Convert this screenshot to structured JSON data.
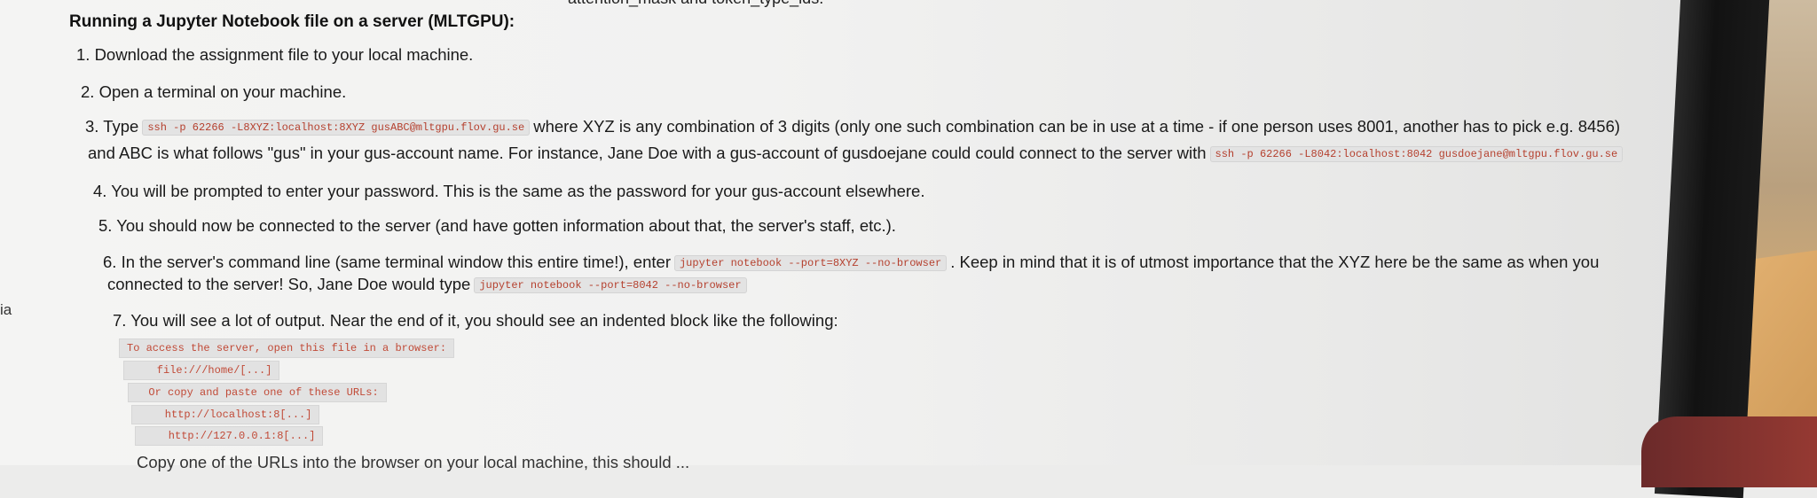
{
  "top_cut_text": "attention_mask and token_type_ids.",
  "heading": "Running a Jupyter Notebook file on a server (MLTGPU):",
  "left_edge_text": "ia",
  "steps": {
    "s1": "1. Download the assignment file to your local machine.",
    "s2": "2. Open a terminal on your machine.",
    "s3_prefix": "3. Type",
    "s3_code": "ssh -p 62266 -L8XYZ:localhost:8XYZ  gusABC@mltgpu.flov.gu.se",
    "s3_mid": "where XYZ is any combination of 3 digits (only one such combination can be in use at a time - if one person uses 8001, another has to pick e.g. 8456)",
    "s3_line2": "and ABC is what follows \"gus\" in your gus-account name. For instance, Jane Doe with a gus-account of gusdoejane could could connect to the server with",
    "s3_code2": "ssh -p 62266 -L8042:localhost:8042  gusdoejane@mltgpu.flov.gu.se",
    "s4": "4. You will be prompted to enter your password. This is the same as the password for your gus-account elsewhere.",
    "s5": "5. You should now be connected to the server (and have gotten information about that, the server's staff, etc.).",
    "s6_prefix": "6. In the server's command line (same terminal window this entire time!), enter",
    "s6_code": "jupyter notebook --port=8XYZ --no-browser",
    "s6_suffix": ". Keep in mind that it is of utmost importance that the XYZ here be the same as when you",
    "s6_line2": "connected to the server! So, Jane Doe would type",
    "s6_code2": "jupyter notebook --port=8042 --no-browser",
    "s7": "7. You will see a lot of output. Near the end of it, you should see an indented block like the following:",
    "s8_partial": "Copy one of the URLs into the browser on your local machine, this should ..."
  },
  "output_block": [
    "To access the server, open this file in a browser:",
    "    file:///home/[...]",
    "  Or copy and paste one of these URLs:",
    "    http://localhost:8[...]",
    "    http://127.0.0.1:8[...]"
  ]
}
